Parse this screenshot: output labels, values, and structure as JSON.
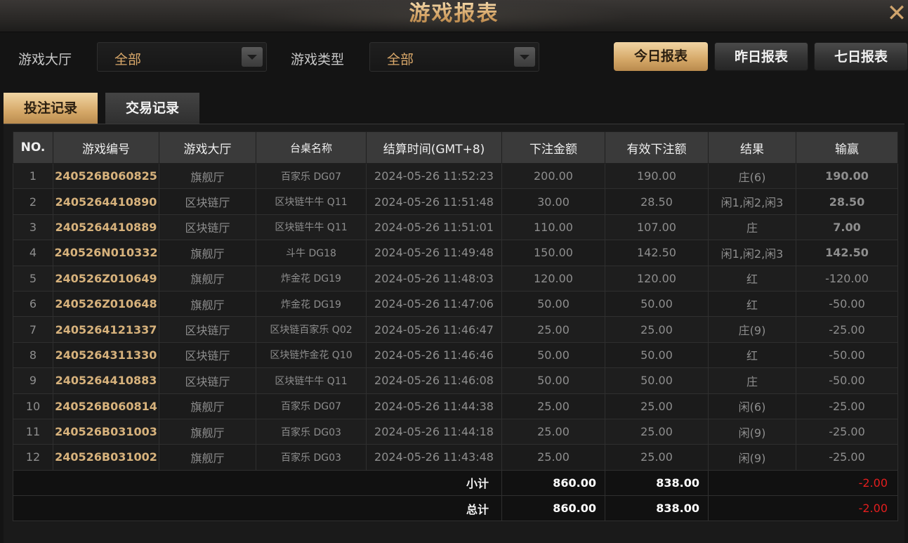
{
  "header": {
    "title": "游戏报表",
    "close_icon": "close-icon"
  },
  "filters": {
    "hall_label": "游戏大厅",
    "hall_value": "全部",
    "type_label": "游戏类型",
    "type_value": "全部"
  },
  "report_buttons": {
    "today": "今日报表",
    "yesterday": "昨日报表",
    "seven_days": "七日报表"
  },
  "tabs": {
    "bets": "投注记录",
    "transactions": "交易记录"
  },
  "columns": [
    "NO.",
    "游戏编号",
    "游戏大厅",
    "台桌名称",
    "结算时间(GMT+8)",
    "下注金额",
    "有效下注额",
    "结果",
    "输赢"
  ],
  "rows": [
    {
      "no": "1",
      "id": "240526B060825",
      "hall": "旗舰厅",
      "table": "百家乐 DG07",
      "time": "2024-05-26 11:52:23",
      "bet": "200.00",
      "valid": "190.00",
      "result": "庄(6)",
      "result_color": "red",
      "win": "190.00"
    },
    {
      "no": "2",
      "id": "2405264410890",
      "hall": "区块链厅",
      "table": "区块链牛牛 Q11",
      "time": "2024-05-26 11:51:48",
      "bet": "30.00",
      "valid": "28.50",
      "result": "闲1,闲2,闲3",
      "result_color": "blue",
      "win": "28.50"
    },
    {
      "no": "3",
      "id": "2405264410889",
      "hall": "区块链厅",
      "table": "区块链牛牛 Q11",
      "time": "2024-05-26 11:51:01",
      "bet": "110.00",
      "valid": "107.00",
      "result": "庄",
      "result_color": "red",
      "win": "7.00"
    },
    {
      "no": "4",
      "id": "240526N010332",
      "hall": "旗舰厅",
      "table": "斗牛 DG18",
      "time": "2024-05-26 11:49:48",
      "bet": "150.00",
      "valid": "142.50",
      "result": "闲1,闲2,闲3",
      "result_color": "blue",
      "win": "142.50"
    },
    {
      "no": "5",
      "id": "240526Z010649",
      "hall": "旗舰厅",
      "table": "炸金花 DG19",
      "time": "2024-05-26 11:48:03",
      "bet": "120.00",
      "valid": "120.00",
      "result": "红",
      "result_color": "red",
      "win": "-120.00"
    },
    {
      "no": "6",
      "id": "240526Z010648",
      "hall": "旗舰厅",
      "table": "炸金花 DG19",
      "time": "2024-05-26 11:47:06",
      "bet": "50.00",
      "valid": "50.00",
      "result": "红",
      "result_color": "red",
      "win": "-50.00"
    },
    {
      "no": "7",
      "id": "2405264121337",
      "hall": "区块链厅",
      "table": "区块链百家乐 Q02",
      "time": "2024-05-26 11:46:47",
      "bet": "25.00",
      "valid": "25.00",
      "result": "庄(9)",
      "result_color": "red",
      "win": "-25.00"
    },
    {
      "no": "8",
      "id": "2405264311330",
      "hall": "区块链厅",
      "table": "区块链炸金花 Q10",
      "time": "2024-05-26 11:46:46",
      "bet": "50.00",
      "valid": "50.00",
      "result": "红",
      "result_color": "red",
      "win": "-50.00"
    },
    {
      "no": "9",
      "id": "2405264410883",
      "hall": "区块链厅",
      "table": "区块链牛牛 Q11",
      "time": "2024-05-26 11:46:08",
      "bet": "50.00",
      "valid": "50.00",
      "result": "庄",
      "result_color": "red",
      "win": "-50.00"
    },
    {
      "no": "10",
      "id": "240526B060814",
      "hall": "旗舰厅",
      "table": "百家乐 DG07",
      "time": "2024-05-26 11:44:38",
      "bet": "25.00",
      "valid": "25.00",
      "result": "闲(6)",
      "result_color": "blue",
      "win": "-25.00"
    },
    {
      "no": "11",
      "id": "240526B031003",
      "hall": "旗舰厅",
      "table": "百家乐 DG03",
      "time": "2024-05-26 11:44:18",
      "bet": "25.00",
      "valid": "25.00",
      "result": "闲(9)",
      "result_color": "blue",
      "win": "-25.00"
    },
    {
      "no": "12",
      "id": "240526B031002",
      "hall": "旗舰厅",
      "table": "百家乐 DG03",
      "time": "2024-05-26 11:43:48",
      "bet": "25.00",
      "valid": "25.00",
      "result": "闲(9)",
      "result_color": "blue",
      "win": "-25.00"
    }
  ],
  "subtotal": {
    "label": "小计",
    "bet": "860.00",
    "valid": "838.00",
    "win": "-2.00"
  },
  "total": {
    "label": "总计",
    "bet": "860.00",
    "valid": "838.00",
    "win": "-2.00"
  },
  "colors": {
    "accent_gold": "#d9a86a",
    "win_positive": "#6ee21c",
    "win_negative": "#e41e1e",
    "result_red": "#e02020",
    "result_blue": "#3d8af0"
  }
}
